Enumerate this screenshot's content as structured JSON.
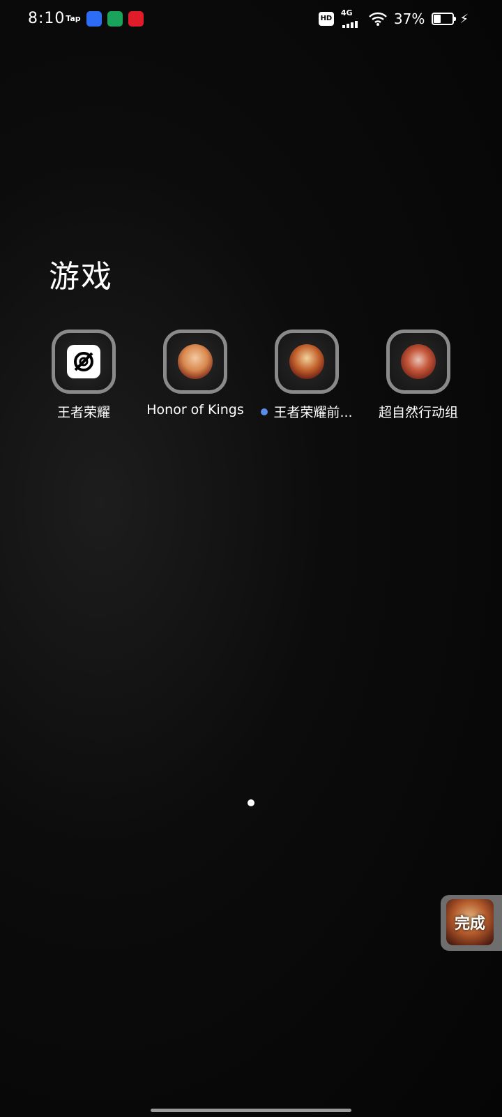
{
  "status_bar": {
    "time": "8:10",
    "notifications": [
      {
        "name": "tap-icon",
        "label": "Tap"
      },
      {
        "name": "baidu-icon"
      },
      {
        "name": "app-green-icon"
      },
      {
        "name": "app-red-icon"
      }
    ],
    "hd_label": "HD",
    "network_label": "4G",
    "battery_percent": "37%",
    "battery_level": 0.37,
    "charging_icon": "bolt-icon"
  },
  "folder": {
    "title": "游戏",
    "apps": [
      {
        "name": "王者荣耀",
        "icon": "logo-icon"
      },
      {
        "name": "Honor of Kings",
        "icon": "avatar-icon"
      },
      {
        "name": "王者荣耀前...",
        "icon": "avatar-icon",
        "badge_color": "#5a8de8"
      },
      {
        "name": "超自然行动组",
        "icon": "avatar-icon"
      }
    ]
  },
  "done_button": {
    "label": "完成"
  },
  "colors": {
    "new_dot": "#5a8de8",
    "icon_border": "#8a8a8a"
  }
}
